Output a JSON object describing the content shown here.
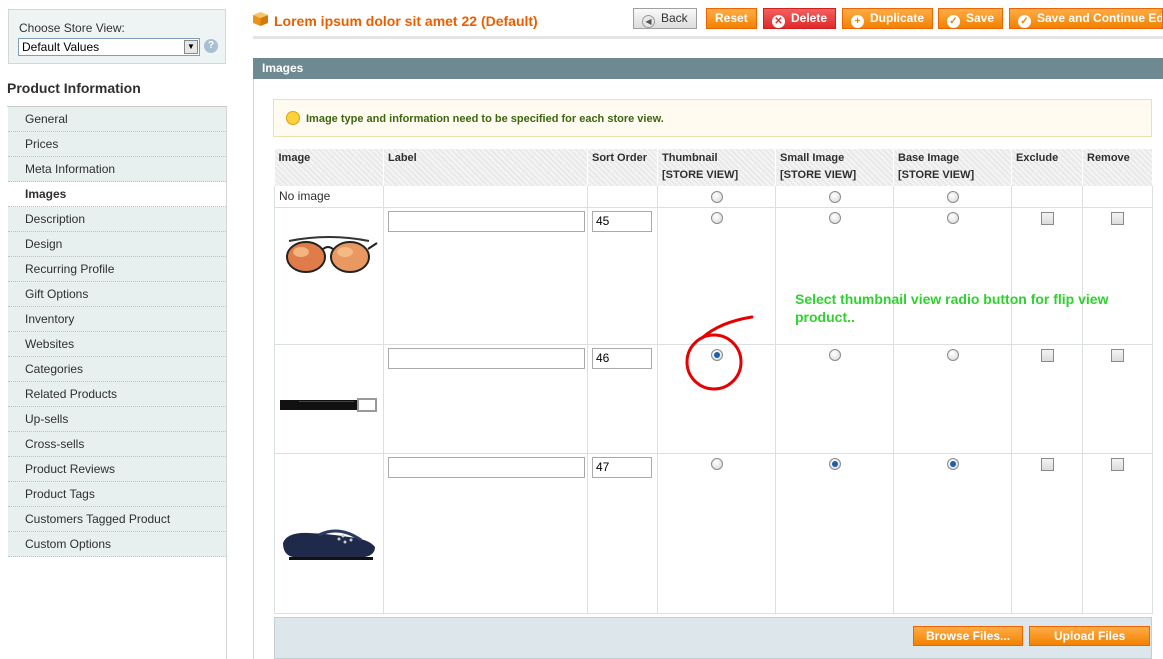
{
  "store_view": {
    "label": "Choose Store View:",
    "selected": "Default Values",
    "help_icon": "help-icon"
  },
  "sidebar": {
    "title": "Product Information",
    "items": [
      {
        "label": "General"
      },
      {
        "label": "Prices"
      },
      {
        "label": "Meta Information"
      },
      {
        "label": "Images",
        "active": true
      },
      {
        "label": "Description"
      },
      {
        "label": "Design"
      },
      {
        "label": "Recurring Profile"
      },
      {
        "label": "Gift Options"
      },
      {
        "label": "Inventory"
      },
      {
        "label": "Websites"
      },
      {
        "label": "Categories"
      },
      {
        "label": "Related Products"
      },
      {
        "label": "Up-sells"
      },
      {
        "label": "Cross-sells"
      },
      {
        "label": "Product Reviews"
      },
      {
        "label": "Product Tags"
      },
      {
        "label": "Customers Tagged Product"
      },
      {
        "label": "Custom Options"
      }
    ]
  },
  "header": {
    "title": "Lorem ipsum dolor sit amet 22 (Default)",
    "icon": "box-icon",
    "buttons": {
      "back": "Back",
      "reset": "Reset",
      "delete": "Delete",
      "duplicate": "Duplicate",
      "save": "Save",
      "save_continue": "Save and Continue Edit"
    }
  },
  "images_section": {
    "title": "Images",
    "notice": "Image type and information need to be specified for each store view.",
    "columns": {
      "image": "Image",
      "label": "Label",
      "sort_order": "Sort Order",
      "thumbnail": "Thumbnail",
      "small_image": "Small Image",
      "base_image": "Base Image",
      "exclude": "Exclude",
      "remove": "Remove",
      "scope": "[STORE VIEW]"
    },
    "no_image_label": "No image",
    "rows": [
      {
        "image": "sunglasses",
        "label": "",
        "sort_order": "45",
        "thumbnail": false,
        "small_image": false,
        "base_image": false,
        "exclude": false,
        "remove": false
      },
      {
        "image": "belt",
        "label": "",
        "sort_order": "46",
        "thumbnail": true,
        "small_image": false,
        "base_image": false,
        "exclude": false,
        "remove": false
      },
      {
        "image": "flat-shoe",
        "label": "",
        "sort_order": "47",
        "thumbnail": false,
        "small_image": true,
        "base_image": true,
        "exclude": false,
        "remove": false
      }
    ],
    "browse_button": "Browse Files...",
    "upload_button": "Upload Files"
  },
  "annotation": {
    "text": "Select thumbnail view radio button for flip view product..",
    "color": "#2fd12f",
    "circle_color": "#e60000"
  },
  "colors": {
    "accent": "#f18200",
    "title": "#eb5e00",
    "section_header": "#6f8992",
    "delete": "#df2a2a"
  }
}
